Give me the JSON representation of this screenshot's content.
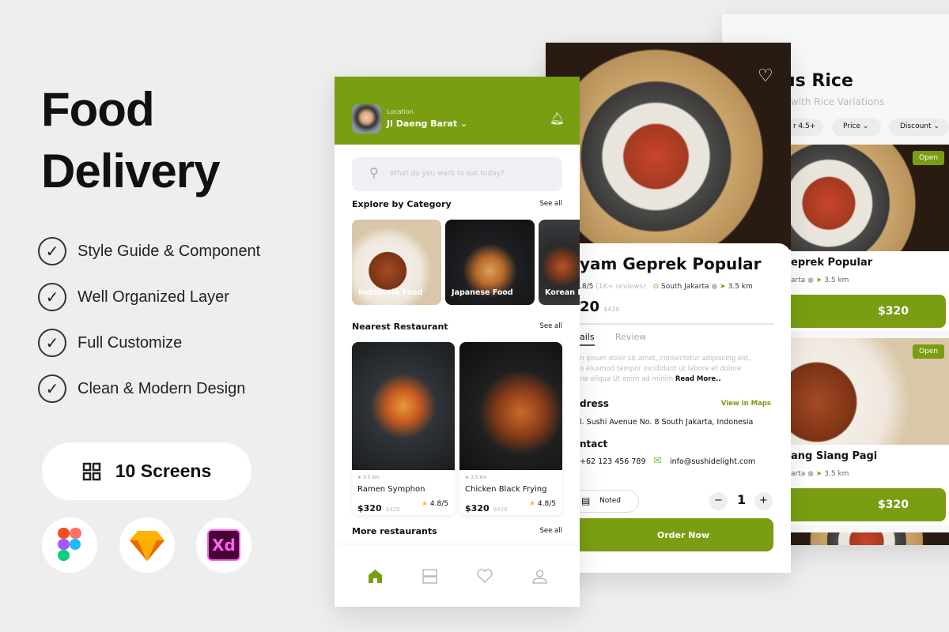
{
  "promo": {
    "title_line1": "Food",
    "title_line2": "Delivery",
    "features": [
      "Style Guide & Component",
      "Well Organized Layer",
      "Full Customize",
      "Clean & Modern Design"
    ],
    "screens_label": "10 Screens",
    "apps": [
      "figma",
      "sketch",
      "Xd"
    ]
  },
  "colors": {
    "accent": "#7a9e12",
    "background": "#eeeeee"
  },
  "home": {
    "location_label": "Location",
    "location_value": "Jl Daeng Barat",
    "search_placeholder": "What do you want to eat today?",
    "explore_title": "Explore by Category",
    "see_all": "See all",
    "categories": [
      "Indonesia Food",
      "Japanese Food",
      "Korean F"
    ],
    "nearest_title": "Nearest Restaurant",
    "restaurants": [
      {
        "distance": "3.5 km",
        "name": "Ramen Symphon",
        "price": "$320",
        "old_price": "$420",
        "rating": "4.8/5"
      },
      {
        "distance": "3.5 km",
        "name": "Chicken Black Frying",
        "price": "$320",
        "old_price": "$420",
        "rating": "4.8/5"
      }
    ],
    "more_title": "More restaurants",
    "nav": [
      "home-icon",
      "orders-icon",
      "heart-icon",
      "profile-icon"
    ]
  },
  "detail": {
    "title": "yam Geprek Popular",
    "rating": ".8/5",
    "reviews": "(1K+ reviews)",
    "location": "South Jakarta",
    "distance": "3.5 km",
    "price": "20",
    "old_price": "$420",
    "tabs": [
      "ails",
      "Review"
    ],
    "description": [
      "n ipsum dolor sit amet, consectetur adipiscing elit,",
      "o eiusmod tempor incididunt ut labore et dolore",
      "na aliqua Ut enim ad minim"
    ],
    "read_more": "Read More..",
    "address_title": "dress",
    "view_maps": "View in Maps",
    "address": "l. Sushi Avenue No. 8 South Jakarta, Indonesia",
    "contact_title": "ntact",
    "phone": "+62 123 456 789",
    "email": "info@sushidelight.com",
    "noted": "Noted",
    "qty": "1",
    "order": "Order Now"
  },
  "list": {
    "title": "us Rice",
    "subtitle": "with Rice Variations",
    "chips": [
      "r 4.5+",
      "Price",
      "Discount"
    ],
    "items": [
      {
        "badge": "Open",
        "name": "eprek Popular",
        "location": "arta",
        "distance": "3.5 km",
        "price": "$320"
      },
      {
        "badge": "Open",
        "name": "ang Siang Pagi",
        "location": "arta",
        "distance": "3.5 km",
        "price": "$320"
      }
    ]
  }
}
